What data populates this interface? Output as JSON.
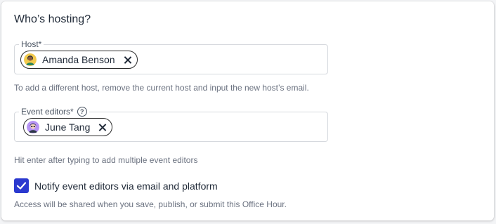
{
  "section": {
    "title": "Who’s hosting?"
  },
  "host_field": {
    "label": "Host*",
    "chip_name": "Amanda Benson",
    "hint": "To add a different host, remove the current host and input the new host’s email."
  },
  "editors_field": {
    "label": "Event editors*",
    "help_icon": "?",
    "chip_name": "June Tang",
    "hint": "Hit enter after typing to add multiple event editors"
  },
  "notify": {
    "checked": true,
    "label": "Notify event editors via email and platform",
    "access_note": "Access will be shared when you save, publish, or submit this Office Hour."
  },
  "colors": {
    "checkbox": "#2b39cf",
    "border": "#d6d9de"
  }
}
